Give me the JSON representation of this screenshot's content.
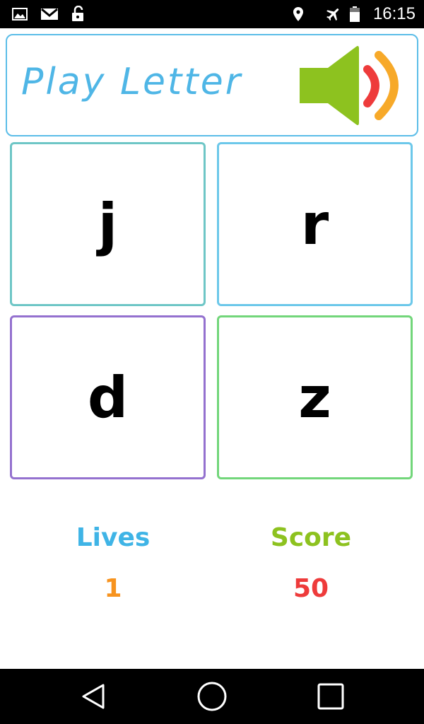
{
  "status_bar": {
    "time": "16:15",
    "icons": [
      "gallery-icon",
      "gmail-icon",
      "unlock-icon",
      "location-icon",
      "airplane-icon",
      "battery-icon"
    ]
  },
  "header": {
    "title": "Play Letter",
    "speaker_icon": "speaker-icon"
  },
  "cards": [
    {
      "letter": "j",
      "border": "#6ec6c6"
    },
    {
      "letter": "r",
      "border": "#6cc8ea"
    },
    {
      "letter": "d",
      "border": "#9471cf"
    },
    {
      "letter": "z",
      "border": "#72d67a"
    }
  ],
  "stats": {
    "lives_label": "Lives",
    "lives_value": "1",
    "score_label": "Score",
    "score_value": "50"
  },
  "colors": {
    "lives_label": "#3fb4e6",
    "lives_value": "#f7931e",
    "score_label": "#8dc21f",
    "score_value": "#ee3b3b",
    "header_border": "#5bbde8",
    "title": "#4fb6e6",
    "speaker_body": "#8dc21f",
    "speaker_wave_inner": "#ee3b3b",
    "speaker_wave_outer": "#f7a929"
  },
  "nav_bar": {
    "icons": [
      "back-icon",
      "home-icon",
      "recents-icon"
    ]
  }
}
